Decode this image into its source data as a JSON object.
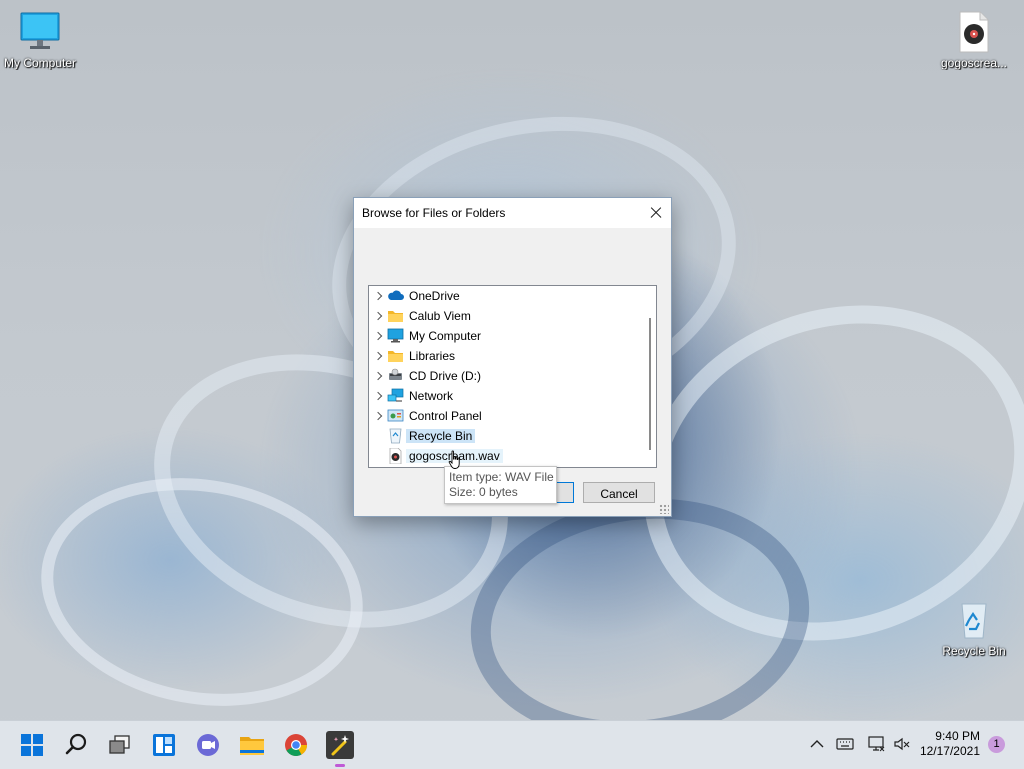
{
  "desktop": {
    "icons": [
      {
        "label": "My Computer",
        "icon": "monitor-icon"
      },
      {
        "label": "gogoscrea...",
        "icon": "audio-file-icon"
      },
      {
        "label": "Recycle Bin",
        "icon": "recycle-bin-icon"
      }
    ]
  },
  "dialog": {
    "title": "Browse for Files or Folders",
    "tree": [
      {
        "label": "OneDrive",
        "icon": "cloud-icon",
        "expandable": true
      },
      {
        "label": "Calub Viem",
        "icon": "folder-icon",
        "expandable": true
      },
      {
        "label": "My Computer",
        "icon": "monitor-icon",
        "expandable": true
      },
      {
        "label": "Libraries",
        "icon": "folder-icon",
        "expandable": true
      },
      {
        "label": "CD Drive (D:)",
        "icon": "cd-drive-icon",
        "expandable": true
      },
      {
        "label": "Network",
        "icon": "network-icon",
        "expandable": true
      },
      {
        "label": "Control Panel",
        "icon": "control-panel-icon",
        "expandable": true
      },
      {
        "label": "Recycle Bin",
        "icon": "recycle-bin-icon",
        "expandable": false,
        "state": "selected"
      },
      {
        "label": "gogoscream.wav",
        "icon": "audio-file-icon",
        "expandable": false,
        "state": "hover"
      }
    ],
    "ok_label": "",
    "cancel_label": "Cancel"
  },
  "tooltip": {
    "line1": "Item type: WAV File",
    "line2": "Size: 0 bytes"
  },
  "taskbar": {
    "apps": [
      "start-icon",
      "search-icon",
      "task-view-icon",
      "widgets-icon",
      "chat-icon",
      "file-explorer-icon",
      "chrome-icon",
      "wand-app-icon"
    ],
    "time": "9:40 PM",
    "date": "12/17/2021",
    "notification_count": "1"
  }
}
